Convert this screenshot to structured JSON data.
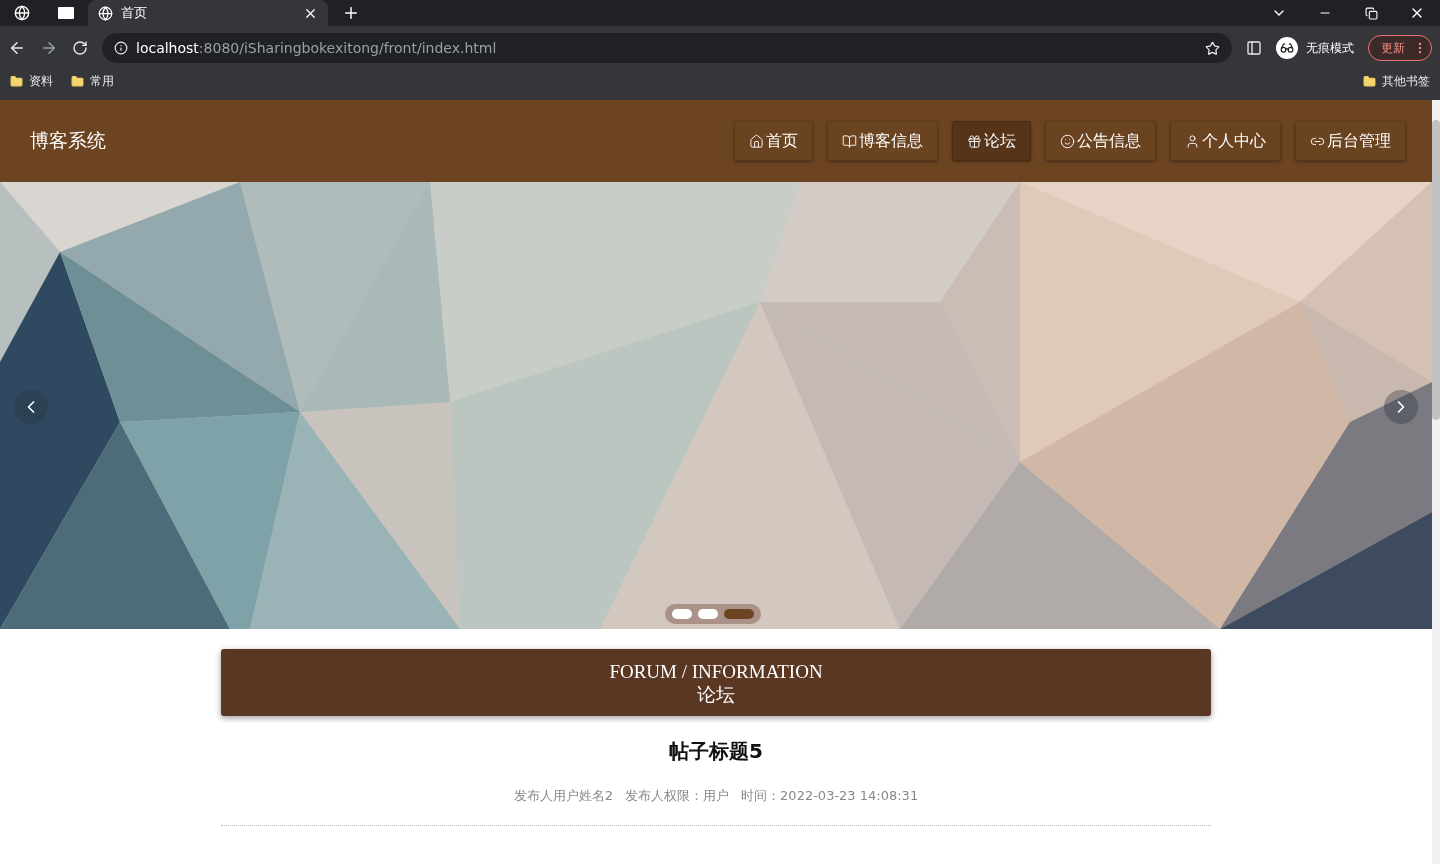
{
  "browser": {
    "tabs": [
      {
        "label": "首页",
        "selected": true
      }
    ],
    "address": {
      "host": "localhost",
      "path": ":8080/iSharingbokexitong/front/index.html"
    },
    "profile_label": "无痕模式",
    "update_button": "更新",
    "bookmarks": [
      {
        "label": "资料"
      },
      {
        "label": "常用"
      }
    ],
    "other_bookmarks": "其他书签"
  },
  "site": {
    "title": "博客系统",
    "nav": [
      {
        "label": "首页",
        "kind": "home",
        "selected": false
      },
      {
        "label": "博客信息",
        "kind": "book",
        "selected": false
      },
      {
        "label": "论坛",
        "kind": "gift",
        "selected": true
      },
      {
        "label": "公告信息",
        "kind": "smile",
        "selected": false
      },
      {
        "label": "个人中心",
        "kind": "user",
        "selected": false
      },
      {
        "label": "后台管理",
        "kind": "link",
        "selected": false
      }
    ],
    "carousel": {
      "dots": [
        {
          "selected": false
        },
        {
          "selected": false
        },
        {
          "selected": true
        }
      ]
    },
    "section": {
      "english": "FORUM / INFORMATION",
      "chinese": "论坛"
    },
    "post": {
      "title": "帖子标题5",
      "meta": [
        "发布人用户姓名2",
        "发布人权限：用户",
        "时间：2022-03-23 14:08:31"
      ]
    }
  }
}
